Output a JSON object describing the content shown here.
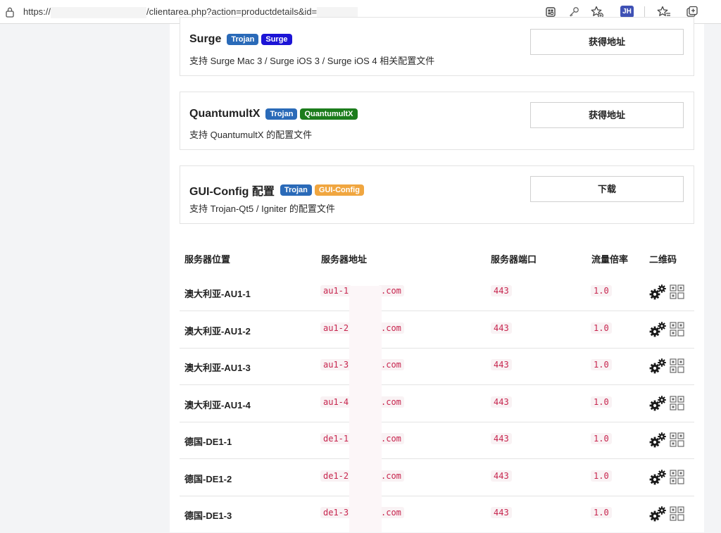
{
  "browser": {
    "url_scheme": "https://",
    "url_path": "/clientarea.php?action=productdetails&id=",
    "profile_badge": "JH"
  },
  "cards": [
    {
      "title": "Surge",
      "badges": [
        {
          "label": "Trojan",
          "color": "#2a6ab8"
        },
        {
          "label": "Surge",
          "color": "#1c14d6"
        }
      ],
      "description": "支持 Surge Mac 3 / Surge iOS 3 / Surge iOS 4 相关配置文件",
      "button": "获得地址"
    },
    {
      "title": "QuantumultX",
      "badges": [
        {
          "label": "Trojan",
          "color": "#2a6ab8"
        },
        {
          "label": "QuantumultX",
          "color": "#1c7c1c"
        }
      ],
      "description": "支持 QuantumultX 的配置文件",
      "button": "获得地址"
    },
    {
      "title": "GUI-Config 配置",
      "badges": [
        {
          "label": "Trojan",
          "color": "#2a6ab8"
        },
        {
          "label": "GUI-Config",
          "color": "#f0a640"
        }
      ],
      "description": "支持 Trojan-Qt5 / Igniter 的配置文件",
      "button": "下载"
    }
  ],
  "table": {
    "headers": [
      "服务器位置",
      "服务器地址",
      "服务器端口",
      "流量倍率",
      "二维码"
    ],
    "rows": [
      {
        "location": "澳大利亚-AU1-1",
        "addr_prefix": "au1-1",
        "addr_suffix": ".com",
        "port": "443",
        "rate": "1.0"
      },
      {
        "location": "澳大利亚-AU1-2",
        "addr_prefix": "au1-2",
        "addr_suffix": ".com",
        "port": "443",
        "rate": "1.0"
      },
      {
        "location": "澳大利亚-AU1-3",
        "addr_prefix": "au1-3",
        "addr_suffix": ".com",
        "port": "443",
        "rate": "1.0"
      },
      {
        "location": "澳大利亚-AU1-4",
        "addr_prefix": "au1-4",
        "addr_suffix": ".com",
        "port": "443",
        "rate": "1.0"
      },
      {
        "location": "德国-DE1-1",
        "addr_prefix": "de1-1",
        "addr_suffix": ".com",
        "port": "443",
        "rate": "1.0"
      },
      {
        "location": "德国-DE1-2",
        "addr_prefix": "de1-2",
        "addr_suffix": ".com",
        "port": "443",
        "rate": "1.0"
      },
      {
        "location": "德国-DE1-3",
        "addr_prefix": "de1-3",
        "addr_suffix": ".com",
        "port": "443",
        "rate": "1.0"
      }
    ]
  },
  "icons": {
    "row_actions": [
      "gear-icon",
      "qr-code-icon"
    ],
    "toolbar": [
      "extensions-icon",
      "key-icon",
      "star-add-icon",
      "favorites-icon",
      "collections-icon"
    ]
  }
}
